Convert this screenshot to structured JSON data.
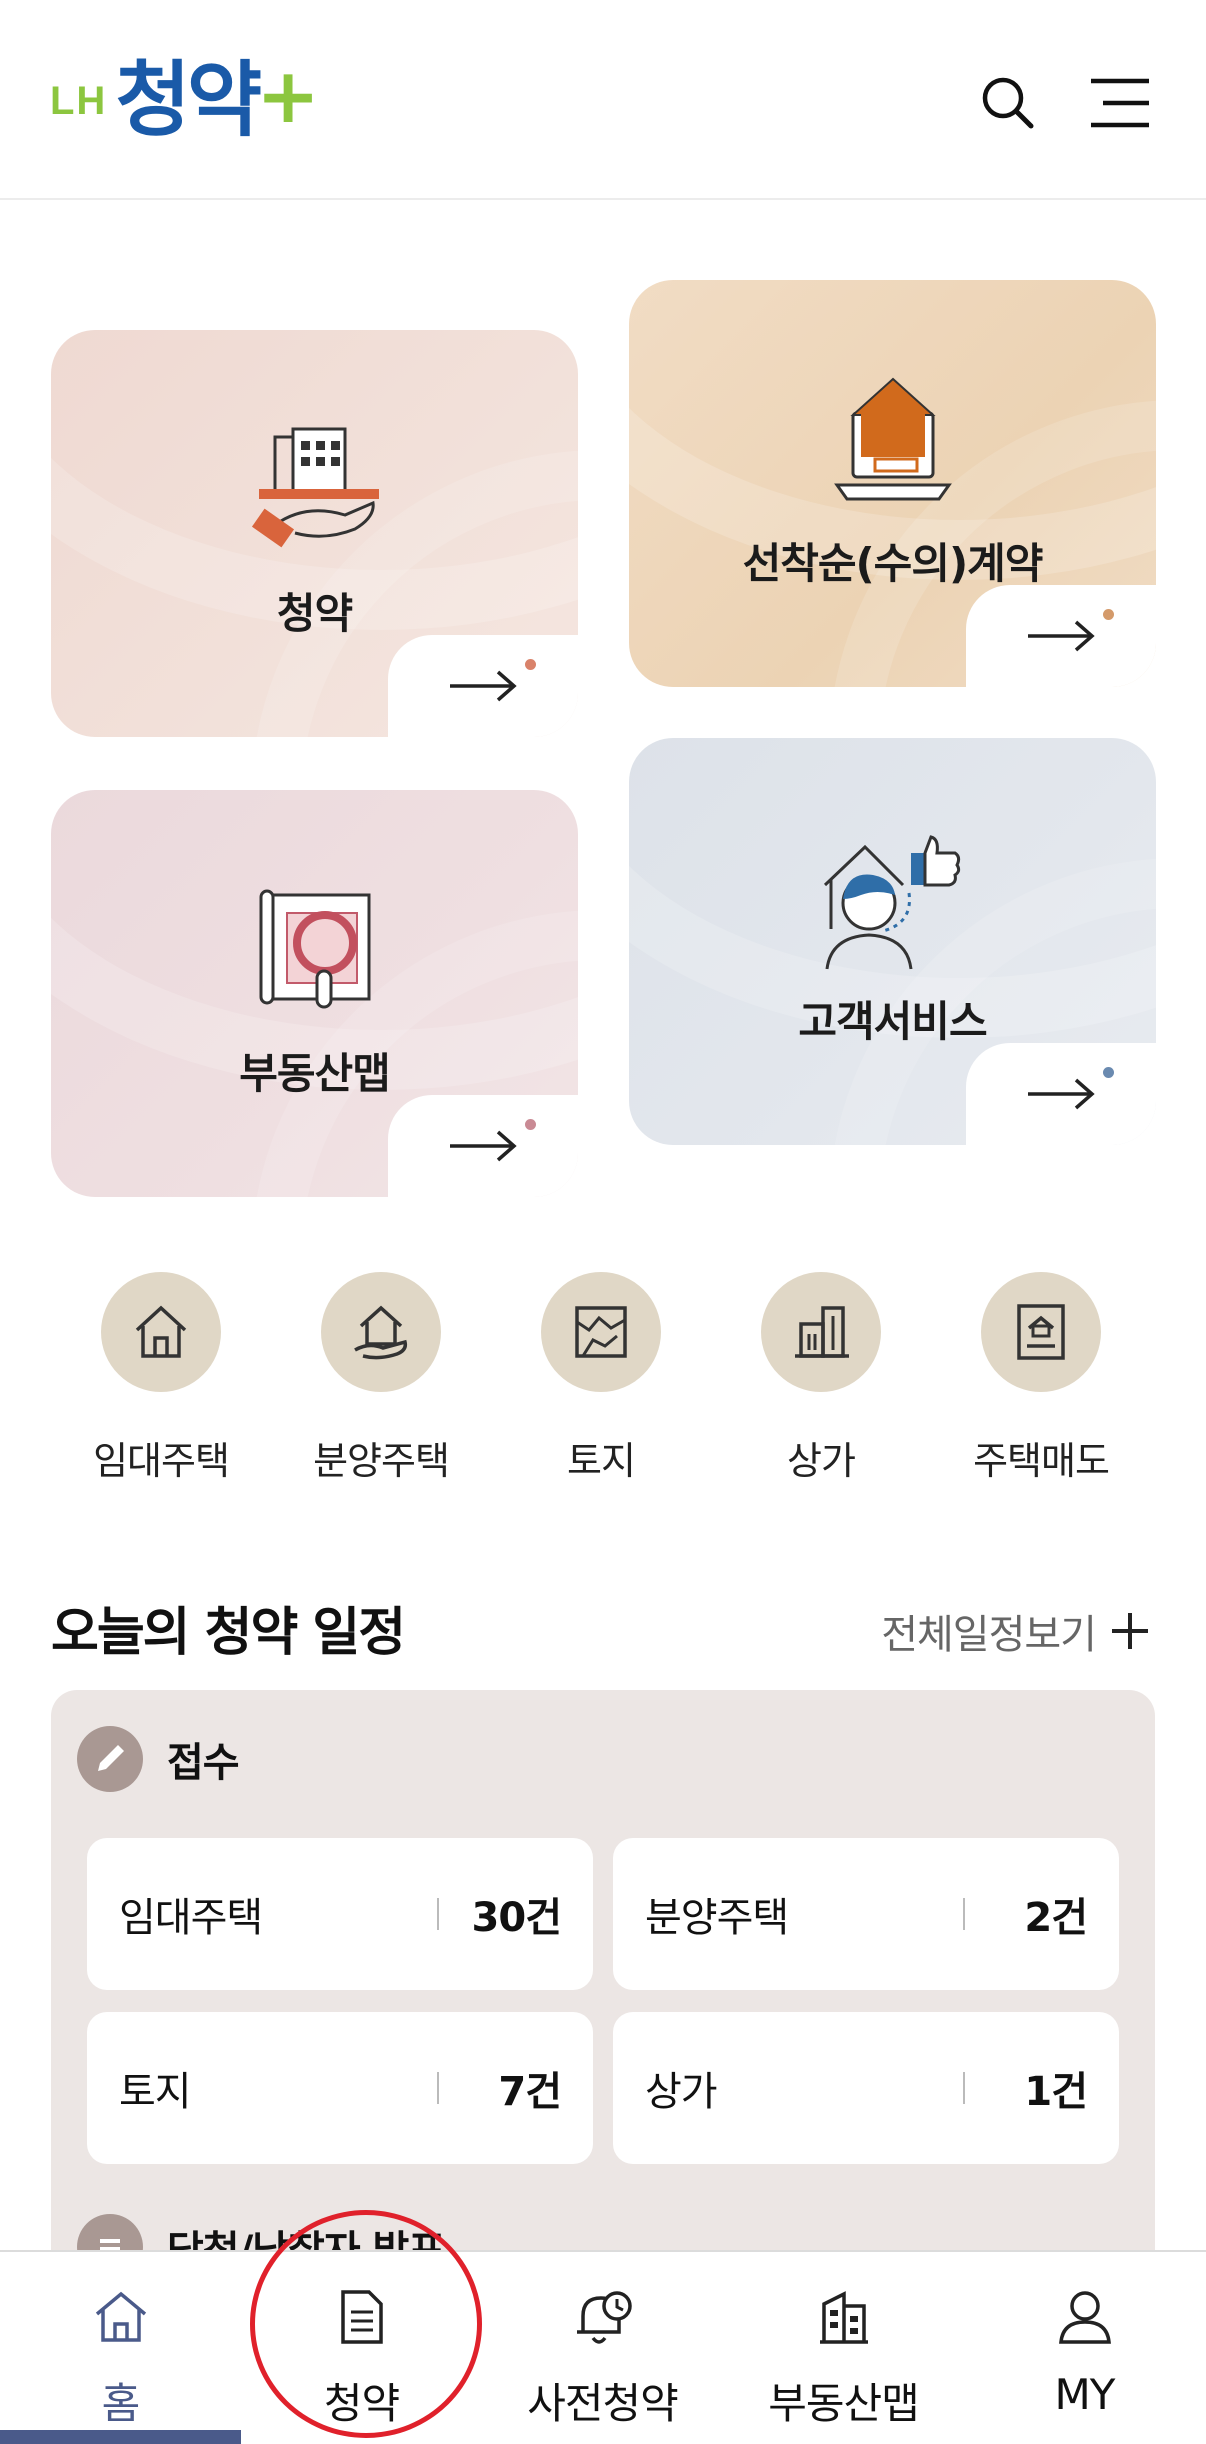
{
  "header": {
    "logo_prefix": "LH",
    "logo_name": "청약",
    "logo_plus": "+",
    "search_icon": "search-icon",
    "menu_icon": "hamburger-menu-icon"
  },
  "cards": {
    "apply": {
      "title": "청약",
      "icon": "building-hand-icon",
      "dot_color": "#d9826a"
    },
    "first_come": {
      "title": "선착순(수의)계약",
      "icon": "house-laptop-icon",
      "dot_color": "#d49a6a"
    },
    "real_estate_map": {
      "title": "부동산맵",
      "icon": "map-magnifier-icon",
      "dot_color": "#c98a94"
    },
    "customer_service": {
      "title": "고객서비스",
      "icon": "customer-thumbs-up-icon",
      "dot_color": "#6a8ab0"
    }
  },
  "quick_menu": [
    {
      "label": "임대주택",
      "icon": "house-icon"
    },
    {
      "label": "분양주택",
      "icon": "house-hand-icon"
    },
    {
      "label": "토지",
      "icon": "land-map-icon"
    },
    {
      "label": "상가",
      "icon": "commercial-building-icon"
    },
    {
      "label": "주택매도",
      "icon": "house-document-icon"
    }
  ],
  "schedule": {
    "title": "오늘의 청약 일정",
    "view_all": "전체일정보기",
    "reception": {
      "heading": "접수",
      "items": [
        {
          "name": "임대주택",
          "count": "30건"
        },
        {
          "name": "분양주택",
          "count": "2건"
        },
        {
          "name": "토지",
          "count": "7건"
        },
        {
          "name": "상가",
          "count": "1건"
        }
      ]
    },
    "winners": {
      "heading": "당첨/낙찰자 발표"
    }
  },
  "bottom_nav": [
    {
      "label": "홈",
      "icon": "home-icon",
      "active": true
    },
    {
      "label": "청약",
      "icon": "document-icon",
      "active": false
    },
    {
      "label": "사전청약",
      "icon": "bell-clock-icon",
      "active": false
    },
    {
      "label": "부동산맵",
      "icon": "building-map-icon",
      "active": false
    },
    {
      "label": "MY",
      "icon": "person-icon",
      "active": false
    }
  ],
  "colors": {
    "brand_blue": "#1a5aa8",
    "brand_green": "#8cc63f",
    "nav_active": "#4a5a8a",
    "highlight_red": "#e0212b"
  }
}
